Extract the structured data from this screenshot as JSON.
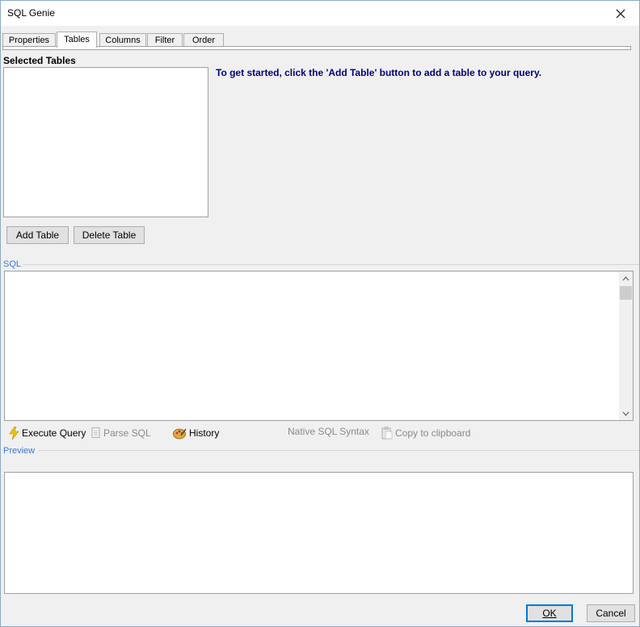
{
  "window": {
    "title": "SQL Genie"
  },
  "tabs": [
    {
      "label": "Properties"
    },
    {
      "label": "Tables"
    },
    {
      "label": "Columns"
    },
    {
      "label": "Filter"
    },
    {
      "label": "Order"
    }
  ],
  "active_tab": "Tables",
  "tables_section": {
    "label": "Selected Tables",
    "hint": "To get started, click the 'Add Table' button to add a table to your query.",
    "add_button": "Add Table",
    "delete_button": "Delete Table"
  },
  "sql_section": {
    "label": "SQL",
    "text": ""
  },
  "toolbar": {
    "execute_query": "Execute Query",
    "parse_sql": "Parse SQL",
    "history": "History",
    "native_sql_syntax": "Native SQL Syntax",
    "copy_to_clipboard": "Copy to clipboard"
  },
  "preview_section": {
    "label": "Preview"
  },
  "dialog_buttons": {
    "ok_label": "OK",
    "cancel_label": "Cancel"
  },
  "colors": {
    "hint_text": "#000080",
    "group_label": "#3c78d8",
    "accent": "#0078d7"
  }
}
